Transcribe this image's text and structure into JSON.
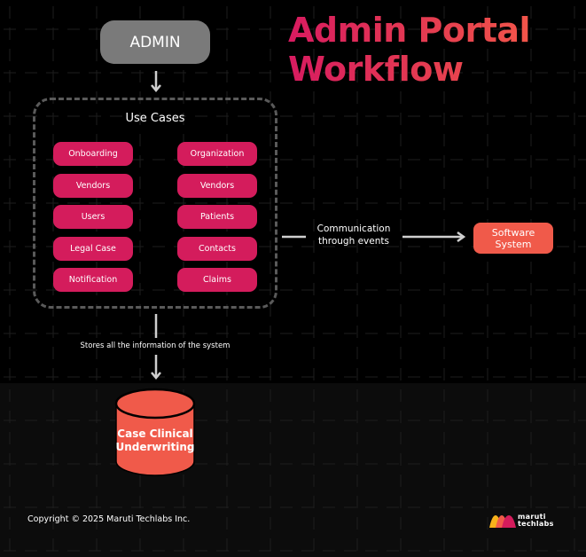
{
  "title": {
    "line1": "Admin Portal",
    "line2": "Workflow",
    "gradient_start": "#d81b60",
    "gradient_end": "#f2554a"
  },
  "admin_node": {
    "label": "ADMIN",
    "color": "#7a7a7a"
  },
  "use_cases": {
    "title": "Use Cases",
    "pill_color": "#d41c5c",
    "left_column": [
      "Onboarding",
      "Vendors",
      "Users",
      "Legal Case",
      "Notification"
    ],
    "right_column": [
      "Organization",
      "Vendors",
      "Patients",
      "Contacts",
      "Claims"
    ]
  },
  "connection": {
    "label_line1": "Communication",
    "label_line2": "through events"
  },
  "software_system": {
    "line1": "Software",
    "line2": "System",
    "color": "#f05a4a"
  },
  "storage": {
    "label": "Stores all the information of the system"
  },
  "database": {
    "line1": "Case Clinical",
    "line2": "Underwriting",
    "color": "#f05a4a"
  },
  "footer": {
    "copyright": "Copyright © 2025 Maruti Techlabs Inc.",
    "logo_line1": "maruti",
    "logo_line2": "techlabs",
    "logo_icon": "maruti-techlabs-logo-icon"
  }
}
